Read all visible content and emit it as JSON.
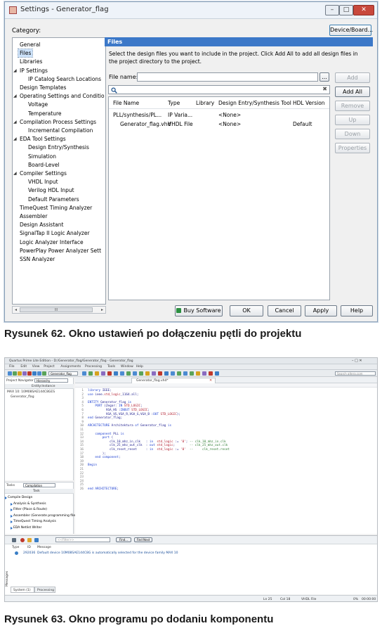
{
  "dialog": {
    "title": "Settings - Generator_flag",
    "window_buttons": [
      "–",
      "□",
      "✕"
    ],
    "category_label": "Category:",
    "device_board_button": "Device/Board...",
    "categories": [
      {
        "label": "General",
        "level": 0,
        "expander": false
      },
      {
        "label": "Files",
        "level": 0,
        "expander": false,
        "selected": true
      },
      {
        "label": "Libraries",
        "level": 0,
        "expander": false
      },
      {
        "label": "IP Settings",
        "level": 0,
        "expander": true
      },
      {
        "label": "IP Catalog Search Locations",
        "level": 1,
        "expander": false
      },
      {
        "label": "Design Templates",
        "level": 0,
        "expander": false
      },
      {
        "label": "Operating Settings and Conditio",
        "level": 0,
        "expander": true
      },
      {
        "label": "Voltage",
        "level": 1,
        "expander": false
      },
      {
        "label": "Temperature",
        "level": 1,
        "expander": false
      },
      {
        "label": "Compilation Process Settings",
        "level": 0,
        "expander": true
      },
      {
        "label": "Incremental Compilation",
        "level": 1,
        "expander": false
      },
      {
        "label": "EDA Tool Settings",
        "level": 0,
        "expander": true
      },
      {
        "label": "Design Entry/Synthesis",
        "level": 1,
        "expander": false
      },
      {
        "label": "Simulation",
        "level": 1,
        "expander": false
      },
      {
        "label": "Board-Level",
        "level": 1,
        "expander": false
      },
      {
        "label": "Compiler Settings",
        "level": 0,
        "expander": true
      },
      {
        "label": "VHDL Input",
        "level": 1,
        "expander": false
      },
      {
        "label": "Verilog HDL Input",
        "level": 1,
        "expander": false
      },
      {
        "label": "Default Parameters",
        "level": 1,
        "expander": false
      },
      {
        "label": "TimeQuest Timing Analyzer",
        "level": 0,
        "expander": false
      },
      {
        "label": "Assembler",
        "level": 0,
        "expander": false
      },
      {
        "label": "Design Assistant",
        "level": 0,
        "expander": false
      },
      {
        "label": "SignalTap II Logic Analyzer",
        "level": 0,
        "expander": false
      },
      {
        "label": "Logic Analyzer Interface",
        "level": 0,
        "expander": false
      },
      {
        "label": "PowerPlay Power Analyzer Sett",
        "level": 0,
        "expander": false
      },
      {
        "label": "SSN Analyzer",
        "level": 0,
        "expander": false
      }
    ],
    "scroll_grip": "III",
    "files_header": "Files",
    "description": "Select the design files you want to include in the project. Click Add All to add all design files in the project directory to the project.",
    "file_name_label": "File name:",
    "browse_button": "...",
    "search_icon": "search-icon",
    "clear_icon": "✖",
    "side_buttons": [
      {
        "label": "Add",
        "enabled": false
      },
      {
        "label": "Add All",
        "enabled": true
      },
      {
        "label": "Remove",
        "enabled": false
      },
      {
        "label": "Up",
        "enabled": false
      },
      {
        "label": "Down",
        "enabled": false
      },
      {
        "label": "Properties",
        "enabled": false
      }
    ],
    "table": {
      "columns": [
        "File Name",
        "Type",
        "Library",
        "Design Entry/Synthesis Tool",
        "HDL Version"
      ],
      "rows": [
        [
          "PLL/synthesis/PL...",
          "IP Varia...",
          "",
          "<None>",
          ""
        ],
        [
          "Generator_flag.vhd",
          "VHDL File",
          "",
          "<None>",
          "Default"
        ]
      ]
    },
    "bottom_buttons": [
      "Buy Software",
      "OK",
      "Cancel",
      "Apply",
      "Help"
    ]
  },
  "caption1": "Rysunek 62. Okno ustawień po dołączeniu pętli do projektu",
  "quartus": {
    "title": "Quartus Prime Lite Edition - D:/Generator_flag/Generator_flag - Generator_flag",
    "menu": [
      "File",
      "Edit",
      "View",
      "Project",
      "Assignments",
      "Processing",
      "Tools",
      "Window",
      "Help"
    ],
    "project_combo": "Generator_flag",
    "search_hint": "Search altera.com",
    "navigator_label": "Project Navigator",
    "hierarchy_combo": "Hierarchy",
    "entity_header": "Entity:Instance",
    "device_row": "MAX 10: 10M08SAE144C8GES",
    "top_entity": "Generator_flag",
    "editor_tab": "Generator_flag.vhd*",
    "code_lines": [
      "library IEEE;",
      "use ieee.std_logic_1164.all;",
      "",
      "ENTITY Generator_flag is",
      "    PORT (Zegar: IN STD_LOGIC;",
      "          VGA_HS :INOUT STD_LOGIC;",
      "          VGA_VS,VGA_R,VGA_G,VGA_B :OUT STD_LOGIC);",
      "end Generator_flag;",
      "",
      "ARCHITECTURE Architektura of Generator_flag is",
      "",
      "    component PLL is",
      "        port (",
      "            clk_10_mhz_in_clk   : in  std_logic := '0'; -- clk_10_mhz_in.clk",
      "            clk_25_mhz_out_clk  : out std_logic;        -- clk_25_mhz_out.clk",
      "            clk_reset_reset     : in  std_logic := '0'  --     clk_reset.reset",
      "        );",
      "    end component;",
      "",
      "Begin",
      "",
      "",
      "",
      "",
      "",
      "end ARCHITECTURE;"
    ],
    "tasks_label": "Tasks",
    "tasks_combo": "Compilation",
    "task_header": "Task",
    "tasks": [
      "Compile Design",
      "Analysis & Synthesis",
      "Fitter (Place & Route)",
      "Assembler (Generate programming files)",
      "TimeQuest Timing Analysis",
      "EDA Netlist Writer"
    ],
    "filter_hint": "<<Filter>>",
    "find_button": "Find...",
    "find_next_button": "Find Next",
    "msg_columns": [
      "Type",
      "ID",
      "Message"
    ],
    "message_id": "292036",
    "message_text": "Default device 10M08SAE144C8G is automatically selected for the device family MAX 10",
    "bottom_tabs": [
      "System (1)",
      "Processing"
    ],
    "status": [
      "Ln 25",
      "Col 18",
      "VHDL File",
      "0%",
      "00:00:00"
    ],
    "side_label": "Messages"
  },
  "caption2": "Rysunek 63. Okno programu po dodaniu komponentu"
}
